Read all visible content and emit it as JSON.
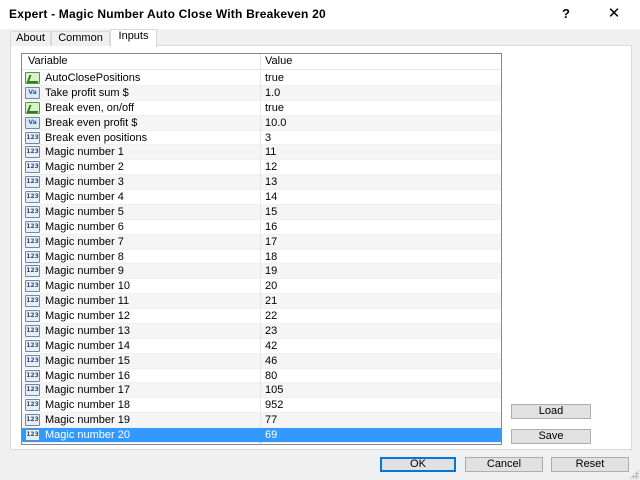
{
  "window": {
    "title": "Expert - Magic Number Auto Close With Breakeven 20",
    "help_label": "?",
    "close_label": "✕"
  },
  "tabs": [
    {
      "label": "About",
      "active": false
    },
    {
      "label": "Common",
      "active": false
    },
    {
      "label": "Inputs",
      "active": true
    }
  ],
  "grid": {
    "headers": {
      "variable": "Variable",
      "value": "Value"
    },
    "rows": [
      {
        "name": "AutoClosePositions",
        "value": "true",
        "type": "bool",
        "icon_text": ""
      },
      {
        "name": "Take profit sum $",
        "value": "1.0",
        "type": "dbl",
        "icon_text": "Va"
      },
      {
        "name": "Break even, on/off",
        "value": "true",
        "type": "bool",
        "icon_text": ""
      },
      {
        "name": "Break even profit $",
        "value": "10.0",
        "type": "dbl",
        "icon_text": "Va"
      },
      {
        "name": "Break even positions",
        "value": "3",
        "type": "int",
        "icon_text": "123"
      },
      {
        "name": "Magic number 1",
        "value": "11",
        "type": "int",
        "icon_text": "123"
      },
      {
        "name": "Magic number 2",
        "value": "12",
        "type": "int",
        "icon_text": "123"
      },
      {
        "name": "Magic number 3",
        "value": "13",
        "type": "int",
        "icon_text": "123"
      },
      {
        "name": "Magic number 4",
        "value": "14",
        "type": "int",
        "icon_text": "123"
      },
      {
        "name": "Magic number 5",
        "value": "15",
        "type": "int",
        "icon_text": "123"
      },
      {
        "name": "Magic number 6",
        "value": "16",
        "type": "int",
        "icon_text": "123"
      },
      {
        "name": "Magic number 7",
        "value": "17",
        "type": "int",
        "icon_text": "123"
      },
      {
        "name": "Magic number 8",
        "value": "18",
        "type": "int",
        "icon_text": "123"
      },
      {
        "name": "Magic number 9",
        "value": "19",
        "type": "int",
        "icon_text": "123"
      },
      {
        "name": "Magic number 10",
        "value": "20",
        "type": "int",
        "icon_text": "123"
      },
      {
        "name": "Magic number 11",
        "value": "21",
        "type": "int",
        "icon_text": "123"
      },
      {
        "name": "Magic number 12",
        "value": "22",
        "type": "int",
        "icon_text": "123"
      },
      {
        "name": "Magic number 13",
        "value": "23",
        "type": "int",
        "icon_text": "123"
      },
      {
        "name": "Magic number 14",
        "value": "42",
        "type": "int",
        "icon_text": "123"
      },
      {
        "name": "Magic number 15",
        "value": "46",
        "type": "int",
        "icon_text": "123"
      },
      {
        "name": "Magic number 16",
        "value": "80",
        "type": "int",
        "icon_text": "123"
      },
      {
        "name": "Magic number 17",
        "value": "105",
        "type": "int",
        "icon_text": "123"
      },
      {
        "name": "Magic number 18",
        "value": "952",
        "type": "int",
        "icon_text": "123"
      },
      {
        "name": "Magic number 19",
        "value": "77",
        "type": "int",
        "icon_text": "123"
      },
      {
        "name": "Magic number 20",
        "value": "69",
        "type": "int",
        "icon_text": "123",
        "selected": true
      }
    ]
  },
  "side_buttons": {
    "load_label": "Load",
    "save_label": "Save"
  },
  "footer_buttons": {
    "ok_label": "OK",
    "cancel_label": "Cancel",
    "reset_label": "Reset"
  },
  "colors": {
    "selection": "#3399ff",
    "default_button_border": "#0078d7"
  }
}
